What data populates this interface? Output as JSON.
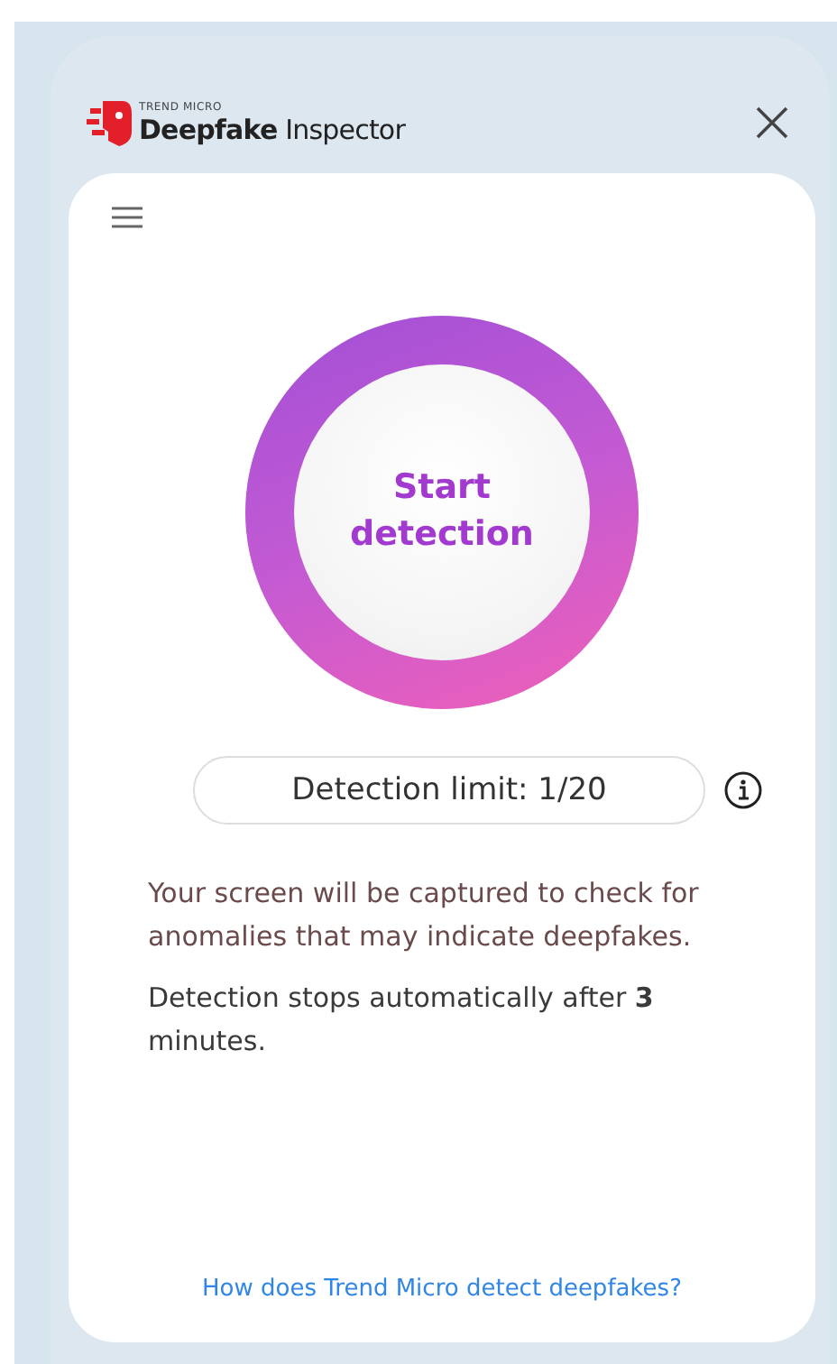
{
  "header": {
    "brand": "TREND MICRO",
    "title": "**Deepfake** Inspector"
  },
  "start_button": {
    "label": "Start detection"
  },
  "detection_limit": "Detection limit: 1/20",
  "notes": [
    "Your screen will be captured to check for anomalies that may indicate deepfakes.",
    "Detection stops automatically after **3** minutes."
  ],
  "help_link": "How does Trend Micro detect deepfakes?"
}
